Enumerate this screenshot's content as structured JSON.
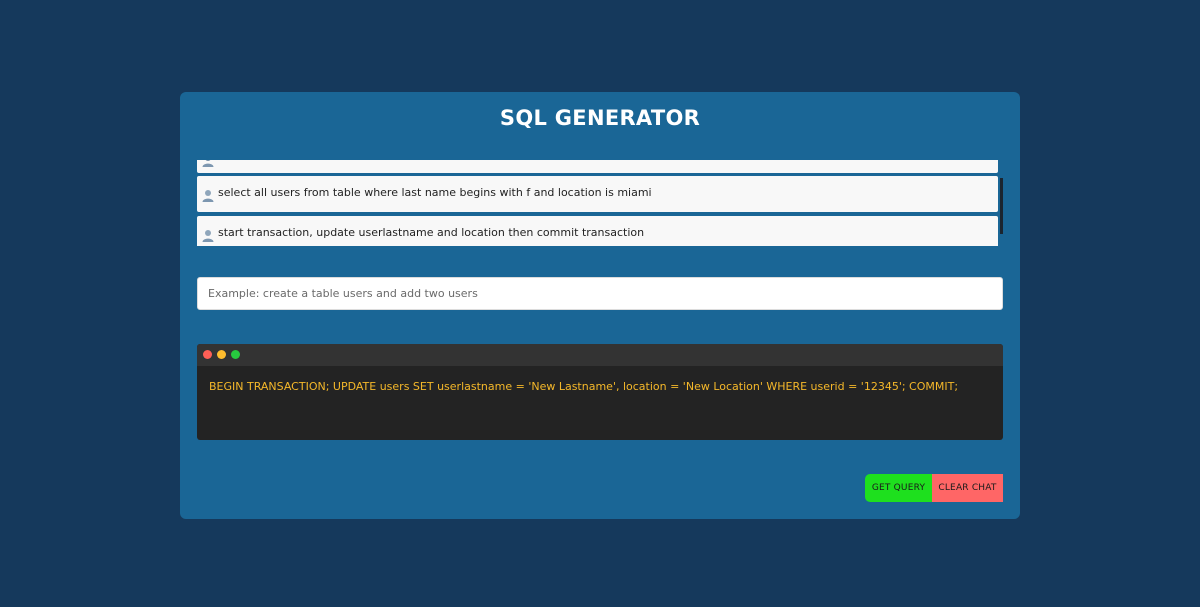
{
  "app": {
    "title": "SQL GENERATOR"
  },
  "chat": {
    "messages": [
      {
        "text": "",
        "avatar_icon": "user-avatar-icon"
      },
      {
        "text": "select all users from table where last name begins with f and location is miami",
        "avatar_icon": "user-avatar-icon"
      },
      {
        "text": "start transaction, update userlastname and location then commit transaction",
        "avatar_icon": "user-avatar-icon"
      }
    ]
  },
  "prompt": {
    "value": "",
    "placeholder": "Example: create a table users and add two users"
  },
  "terminal": {
    "output": "BEGIN TRANSACTION; UPDATE users SET userlastname = 'New Lastname', location = 'New Location' WHERE userid = '12345'; COMMIT;",
    "output_color": "#f5b82a"
  },
  "buttons": {
    "get_query": "GET QUERY",
    "clear_chat": "CLEAR CHAT"
  },
  "colors": {
    "background": "#15395c",
    "card": "#1a6696",
    "get_query": "#1ee01e",
    "clear_chat": "#ff6666"
  }
}
